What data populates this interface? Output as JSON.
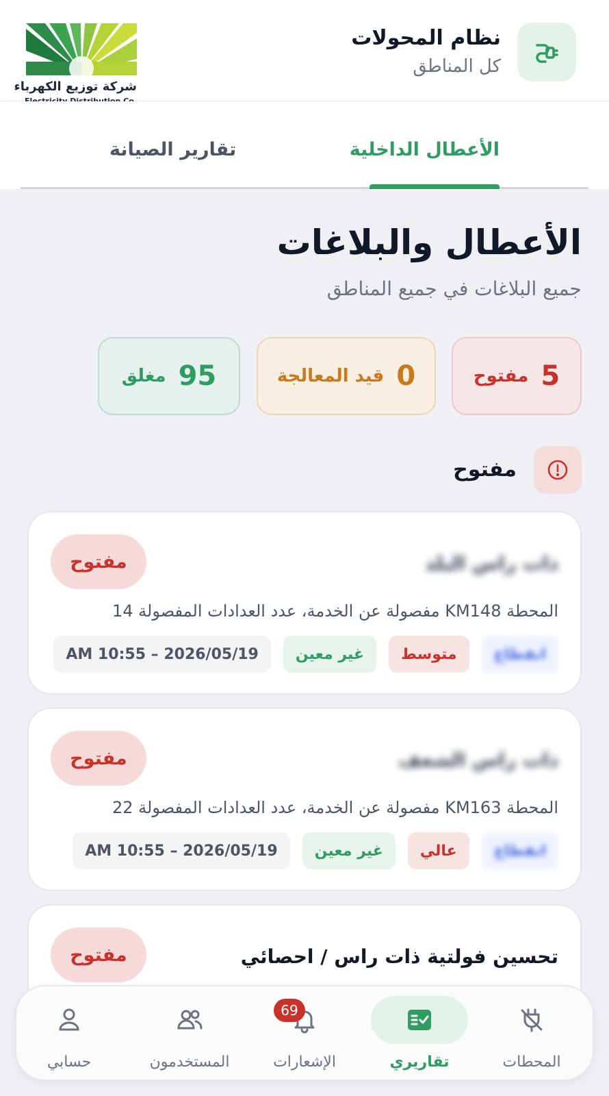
{
  "header": {
    "title": "نظام المحولات",
    "subtitle": "كل المناطق",
    "logo": {
      "arabic": "شركة توزيع الكهرباء",
      "english": "Electricity Distribution Co."
    }
  },
  "tabs": [
    {
      "label": "الأعطال الداخلية",
      "active": true
    },
    {
      "label": "تقارير الصيانة",
      "active": false
    }
  ],
  "page": {
    "title": "الأعطال والبلاغات",
    "subtitle": "جميع البلاغات في جميع المناطق"
  },
  "stats": {
    "open": {
      "count": "5",
      "label": "مفتوح"
    },
    "in_progress": {
      "count": "0",
      "label": "قيد المعالجة"
    },
    "closed": {
      "count": "95",
      "label": "مغلق"
    }
  },
  "section": {
    "title": "مفتوح"
  },
  "reports": [
    {
      "title": "ذات راس البلد",
      "status": "مفتوح",
      "description": "المحطة KM148 مفصولة عن الخدمة، عدد العدادات المفصولة 14",
      "type": "انقطاع",
      "priority": "متوسط",
      "assignee": "غير معين",
      "datetime": "AM 10:55 – 2026/05/19"
    },
    {
      "title": "ذات راس الشعف",
      "status": "مفتوح",
      "description": "المحطة KM163 مفصولة عن الخدمة، عدد العدادات المفصولة 22",
      "type": "انقطاع",
      "priority": "عالي",
      "assignee": "غير معين",
      "datetime": "AM 10:55 – 2026/05/19"
    },
    {
      "title": "تحسين فولتية ذات راس / احصائي",
      "status": "مفتوح"
    }
  ],
  "nav": {
    "stations": "المحطات",
    "reports": "تقاريري",
    "notifications": "الإشعارات",
    "notifications_badge": "69",
    "users": "المستخدمون",
    "account": "حسابي"
  },
  "colors": {
    "brand_green": "#2f9d62",
    "open_red": "#c8322a",
    "progress_orange": "#c97a1c"
  }
}
